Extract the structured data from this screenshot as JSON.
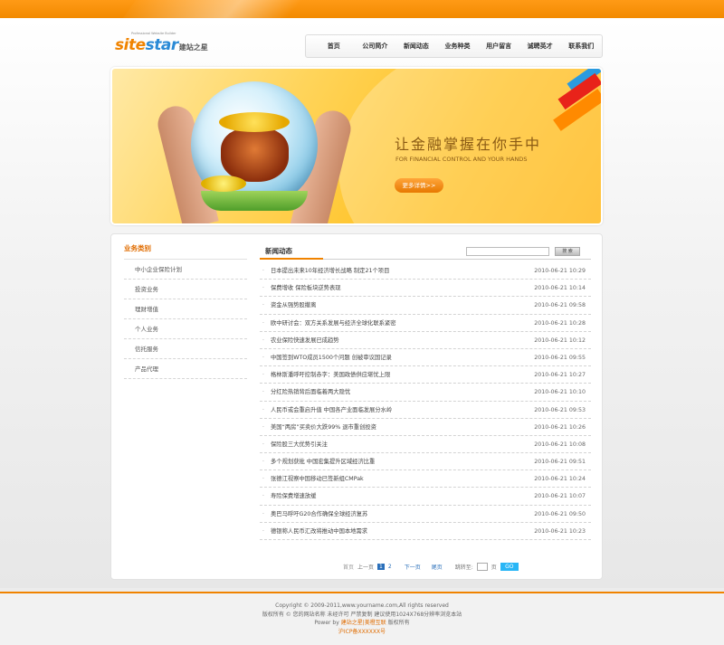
{
  "header": {
    "logo_main": "site",
    "logo_star": "star",
    "logo_cn": "建站之星",
    "logo_tagline": "Professional Website Builder"
  },
  "nav": {
    "items": [
      "首页",
      "公司简介",
      "新闻动态",
      "业务种类",
      "用户留言",
      "诚聘英才",
      "联系我们"
    ]
  },
  "banner": {
    "headline": "让金融掌握在你手中",
    "subtitle": "FOR FINANCIAL CONTROL AND YOUR HANDS",
    "button": "更多详情>>"
  },
  "sidebar": {
    "title": "业务类别",
    "items": [
      "中小企业保险计划",
      "投资业务",
      "理财增值",
      "个人业务",
      "信托服务",
      "产品代理"
    ]
  },
  "news": {
    "title": "新闻动态",
    "search_placeholder": "",
    "search_button": "搜 索",
    "items": [
      {
        "title": "日本提出未来10年经济增长战略 制定21个项目",
        "date": "2010-06-21 10:29"
      },
      {
        "title": "保费增收 保险板块逆势表现",
        "date": "2010-06-21 10:14"
      },
      {
        "title": "资金从强势股撤离",
        "date": "2010-06-21 09:58"
      },
      {
        "title": "欧中研讨会：双方关系发展与经济全球化联系紧密",
        "date": "2010-06-21 10:28"
      },
      {
        "title": "农业保险快速发展已成趋势",
        "date": "2010-06-21 10:12"
      },
      {
        "title": "中国签到WTO成员1500个问题 创被审议国记录",
        "date": "2010-06-21 09:55"
      },
      {
        "title": "格林斯潘呼吁控制赤字：美国政债供应堪忧上限",
        "date": "2010-06-21 10:27"
      },
      {
        "title": "分红险热销背后面临着两大隐忧",
        "date": "2010-06-21 10:10"
      },
      {
        "title": "人民币或会重启升值 中国各产业面临发展分水岭",
        "date": "2010-06-21 09:53"
      },
      {
        "title": "美国“两房”买卖价大跌99% 退市重创投资",
        "date": "2010-06-21 10:26"
      },
      {
        "title": "保险股三大优势引关注",
        "date": "2010-06-21 10:08"
      },
      {
        "title": "多个规划获批 中国宏集提升区域经济比重",
        "date": "2010-06-21 09:51"
      },
      {
        "title": "张德江视察中国移动已签新组CMPak",
        "date": "2010-06-21 10:24"
      },
      {
        "title": "寿险保费增速放缓",
        "date": "2010-06-21 10:07"
      },
      {
        "title": "奥巴马呼吁G20合作确保全球经济复苏",
        "date": "2010-06-21 09:50"
      },
      {
        "title": "德银称人民币汇改将推动中国本地需求",
        "date": "2010-06-21 10:23"
      }
    ]
  },
  "pager": {
    "first": "首页",
    "prev": "上一页",
    "page1": "1",
    "page2": "2",
    "next": "下一页",
    "last": "尾页",
    "jump_label": "跳转至:",
    "page_unit": "页",
    "go": "GO"
  },
  "footer": {
    "copyright": "Copyright © 2009-2011,www.yourname.com,All rights reserved",
    "line2": "版权所有 © 您的网站名称 未经许可 严禁复制 建议使用1024X768分辨率浏览本站",
    "power_prefix": "Power by ",
    "power_link": "建站之星|美橙互联",
    "power_suffix": " 版权所有",
    "icp": "沪ICP备XXXXXX号"
  },
  "colors": {
    "accent": "#f08300",
    "link": "#2a6fba",
    "go_button": "#29b6f6"
  }
}
